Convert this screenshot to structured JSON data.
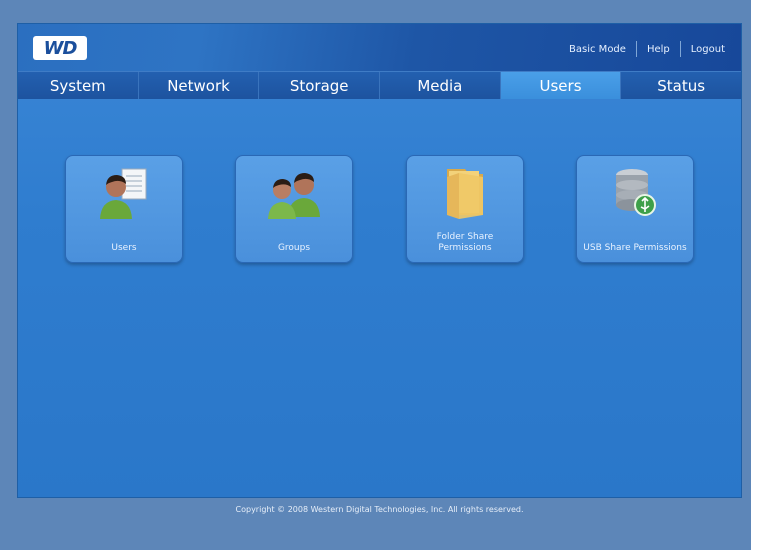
{
  "logo": {
    "text": "WD"
  },
  "top_links": {
    "basic_mode": "Basic Mode",
    "help": "Help",
    "logout": "Logout"
  },
  "tabs": [
    {
      "label": "System"
    },
    {
      "label": "Network"
    },
    {
      "label": "Storage"
    },
    {
      "label": "Media"
    },
    {
      "label": "Users",
      "active": true
    },
    {
      "label": "Status"
    }
  ],
  "cards": [
    {
      "label": "Users",
      "icon": "user-icon"
    },
    {
      "label": "Groups",
      "icon": "group-icon"
    },
    {
      "label": "Folder Share Permissions",
      "icon": "folder-icon"
    },
    {
      "label": "USB Share Permissions",
      "icon": "usb-database-icon"
    }
  ],
  "footer": {
    "copyright": "Copyright © 2008 Western Digital Technologies, Inc. All rights reserved."
  }
}
